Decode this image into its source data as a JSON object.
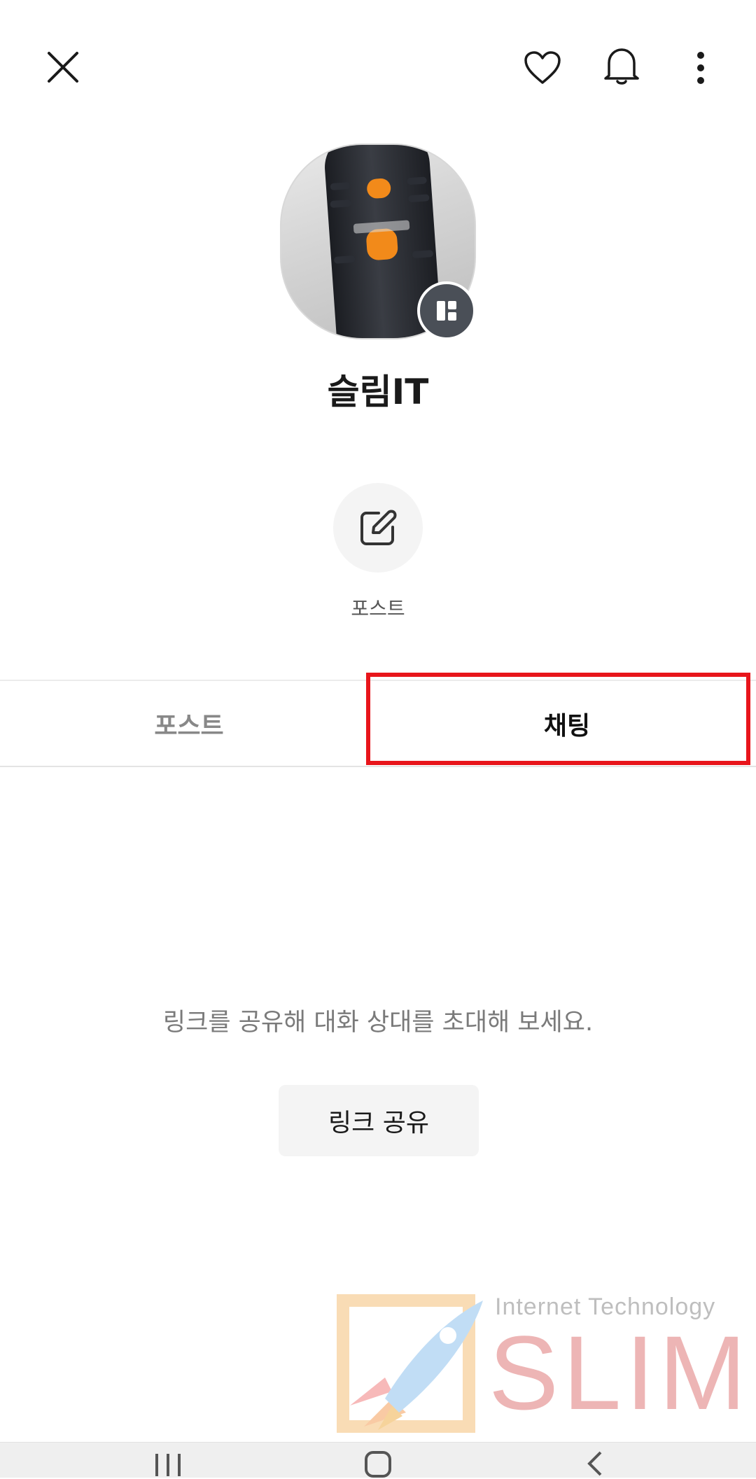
{
  "header": {
    "close_icon": "close-icon",
    "like_icon": "heart-icon",
    "notification_icon": "bell-icon",
    "more_icon": "more-vertical-icon"
  },
  "profile": {
    "name": "슬림IT",
    "avatar_badge_icon": "channel-badge-icon"
  },
  "actions": [
    {
      "label": "포스트",
      "icon": "edit-icon"
    }
  ],
  "tabs": [
    {
      "label": "포스트",
      "selected": false
    },
    {
      "label": "채팅",
      "selected": true
    }
  ],
  "chat_empty": {
    "message": "링크를 공유해 대화 상대를 초대해 보세요.",
    "share_button": "링크 공유"
  },
  "watermark": {
    "tagline": "Internet Technology",
    "brand": "SLIM"
  },
  "colors": {
    "highlight": "#e8151b",
    "badge": "#4a4f57",
    "action_bg": "#f4f4f4",
    "watermark_red": "#e07a7a"
  }
}
